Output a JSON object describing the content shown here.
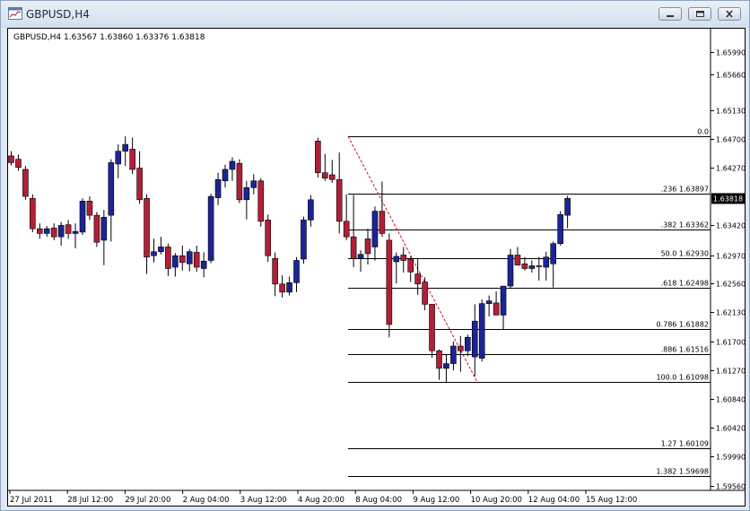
{
  "window": {
    "title": "GBPUSD,H4",
    "icons": [
      "chart-window-icon",
      "minimize-icon",
      "restore-icon",
      "close-icon"
    ]
  },
  "chart_data": {
    "type": "candlestick",
    "symbol": "GBPUSD",
    "timeframe": "H4",
    "header_text": "GBPUSD,H4  1.63567 1.63860 1.63376 1.63818",
    "ohlc_info": [
      "1.63567",
      "1.63860",
      "1.63376",
      "1.63818"
    ],
    "current_price": "1.63818",
    "y_range": [
      1.5949,
      1.6635
    ],
    "y_ticks": [
      "1.65990",
      "1.65660",
      "1.65130",
      "1.64700",
      "1.64270",
      "1.63420",
      "1.62970",
      "1.62560",
      "1.62130",
      "1.61700",
      "1.61270",
      "1.60840",
      "1.60420",
      "1.59990",
      "1.59560"
    ],
    "x_labels": [
      "27 Jul 2011",
      "28 Jul 12:00",
      "29 Jul 20:00",
      "2 Aug 04:00",
      "3 Aug 12:00",
      "4 Aug 20:00",
      "8 Aug 04:00",
      "9 Aug 12:00",
      "10 Aug 20:00",
      "12 Aug 04:00",
      "15 Aug 12:00"
    ],
    "candles": [
      [
        1.6445,
        1.6452,
        1.6431,
        1.6435
      ],
      [
        1.644,
        1.6447,
        1.6423,
        1.6428
      ],
      [
        1.6425,
        1.643,
        1.638,
        1.6385
      ],
      [
        1.6382,
        1.6388,
        1.6332,
        1.6337
      ],
      [
        1.6337,
        1.6345,
        1.6322,
        1.633
      ],
      [
        1.633,
        1.6341,
        1.6325,
        1.6337
      ],
      [
        1.6338,
        1.6345,
        1.632,
        1.6325
      ],
      [
        1.6325,
        1.6347,
        1.6312,
        1.6342
      ],
      [
        1.6343,
        1.635,
        1.6322,
        1.633
      ],
      [
        1.633,
        1.6345,
        1.6308,
        1.6333
      ],
      [
        1.6332,
        1.6382,
        1.6328,
        1.6378
      ],
      [
        1.6378,
        1.6385,
        1.635,
        1.6357
      ],
      [
        1.6357,
        1.6362,
        1.631,
        1.6317
      ],
      [
        1.632,
        1.6365,
        1.6283,
        1.6354
      ],
      [
        1.6357,
        1.644,
        1.6318,
        1.6435
      ],
      [
        1.6433,
        1.6462,
        1.6412,
        1.6452
      ],
      [
        1.6452,
        1.6474,
        1.643,
        1.6462
      ],
      [
        1.6455,
        1.6472,
        1.6418,
        1.6425
      ],
      [
        1.6427,
        1.6452,
        1.6374,
        1.638
      ],
      [
        1.6382,
        1.6388,
        1.627,
        1.6295
      ],
      [
        1.6297,
        1.6322,
        1.6287,
        1.6303
      ],
      [
        1.6303,
        1.6325,
        1.6299,
        1.631
      ],
      [
        1.631,
        1.6315,
        1.6267,
        1.6278
      ],
      [
        1.628,
        1.6301,
        1.6266,
        1.6297
      ],
      [
        1.6297,
        1.6312,
        1.6275,
        1.6287
      ],
      [
        1.6285,
        1.6307,
        1.6274,
        1.6303
      ],
      [
        1.6302,
        1.6312,
        1.6273,
        1.628
      ],
      [
        1.6278,
        1.6302,
        1.6265,
        1.6289
      ],
      [
        1.629,
        1.6389,
        1.6286,
        1.6385
      ],
      [
        1.6383,
        1.642,
        1.6372,
        1.641
      ],
      [
        1.6408,
        1.6432,
        1.6398,
        1.6425
      ],
      [
        1.6425,
        1.6443,
        1.6408,
        1.6437
      ],
      [
        1.6434,
        1.644,
        1.6375,
        1.638
      ],
      [
        1.638,
        1.6408,
        1.6351,
        1.6398
      ],
      [
        1.6398,
        1.6418,
        1.6388,
        1.6408
      ],
      [
        1.6408,
        1.6412,
        1.634,
        1.6348
      ],
      [
        1.635,
        1.6358,
        1.6288,
        1.6297
      ],
      [
        1.6293,
        1.6302,
        1.6237,
        1.6255
      ],
      [
        1.6255,
        1.6268,
        1.6235,
        1.6243
      ],
      [
        1.6243,
        1.6266,
        1.6238,
        1.6257
      ],
      [
        1.6257,
        1.6295,
        1.6243,
        1.629
      ],
      [
        1.6292,
        1.6355,
        1.6285,
        1.635
      ],
      [
        1.635,
        1.6387,
        1.634,
        1.638
      ],
      [
        1.6467,
        1.6472,
        1.6413,
        1.642
      ],
      [
        1.642,
        1.6448,
        1.6408,
        1.6412
      ],
      [
        1.6417,
        1.6439,
        1.6405,
        1.641
      ],
      [
        1.641,
        1.645,
        1.633,
        1.6348
      ],
      [
        1.6348,
        1.6388,
        1.632,
        1.6325
      ],
      [
        1.6325,
        1.6387,
        1.628,
        1.6293
      ],
      [
        1.6293,
        1.6305,
        1.6273,
        1.6299
      ],
      [
        1.6322,
        1.6337,
        1.6284,
        1.63
      ],
      [
        1.631,
        1.637,
        1.629,
        1.6363
      ],
      [
        1.6363,
        1.6407,
        1.6325,
        1.633
      ],
      [
        1.632,
        1.633,
        1.6176,
        1.6195
      ],
      [
        1.6288,
        1.6302,
        1.6256,
        1.6296
      ],
      [
        1.6298,
        1.631,
        1.6272,
        1.629
      ],
      [
        1.6292,
        1.6296,
        1.6258,
        1.6273
      ],
      [
        1.627,
        1.6293,
        1.6239,
        1.6255
      ],
      [
        1.6258,
        1.6265,
        1.6216,
        1.6225
      ],
      [
        1.6225,
        1.6225,
        1.6146,
        1.6156
      ],
      [
        1.6156,
        1.6158,
        1.6113,
        1.613
      ],
      [
        1.613,
        1.615,
        1.611,
        1.6137
      ],
      [
        1.6137,
        1.617,
        1.6127,
        1.6163
      ],
      [
        1.6163,
        1.6178,
        1.6125,
        1.6156
      ],
      [
        1.6156,
        1.618,
        1.6148,
        1.6176
      ],
      [
        1.6147,
        1.6225,
        1.6118,
        1.62
      ],
      [
        1.6145,
        1.6232,
        1.614,
        1.6226
      ],
      [
        1.6226,
        1.6238,
        1.6207,
        1.623
      ],
      [
        1.6227,
        1.6244,
        1.6209,
        1.6209
      ],
      [
        1.6209,
        1.6241,
        1.6188,
        1.6252
      ],
      [
        1.6252,
        1.6307,
        1.6248,
        1.6298
      ],
      [
        1.6298,
        1.631,
        1.6285,
        1.6283
      ],
      [
        1.6285,
        1.6295,
        1.6275,
        1.6278
      ],
      [
        1.6278,
        1.629,
        1.6272,
        1.6282
      ],
      [
        1.6282,
        1.6295,
        1.626,
        1.6281
      ],
      [
        1.628,
        1.6303,
        1.626,
        1.6295
      ],
      [
        1.6285,
        1.6318,
        1.625,
        1.6315
      ],
      [
        1.6315,
        1.6363,
        1.6312,
        1.6358
      ],
      [
        1.6357,
        1.6386,
        1.6338,
        1.6382
      ]
    ],
    "fibonacci": [
      {
        "label": "0.0",
        "value": null
      },
      {
        "label": ".236",
        "value": "1.63897"
      },
      {
        "label": ".382",
        "value": "1.63362"
      },
      {
        "label": "50.0",
        "value": "1.62930"
      },
      {
        "label": ".618",
        "value": "1.62498"
      },
      {
        "label": "0.786",
        "value": "1.61882"
      },
      {
        "label": ".886",
        "value": "1.61516"
      },
      {
        "label": "100.0",
        "value": "1.61098"
      },
      {
        "label": "1.27",
        "value": "1.60109"
      },
      {
        "label": "1.382",
        "value": "1.59698"
      }
    ],
    "fib_levels": [
      1.6474,
      1.63897,
      1.63362,
      1.6293,
      1.62498,
      1.61882,
      1.61516,
      1.61098,
      1.60109,
      1.59698
    ],
    "fib_anchor": {
      "start_price": 1.6474,
      "end_price": 1.61098
    },
    "colors": {
      "bull": "#1c2495",
      "bear": "#b21f37",
      "grid": "#000000",
      "fib_trend": "#c8102e",
      "price_tag_bg": "#000000",
      "price_tag_text": "#ffffff"
    }
  }
}
